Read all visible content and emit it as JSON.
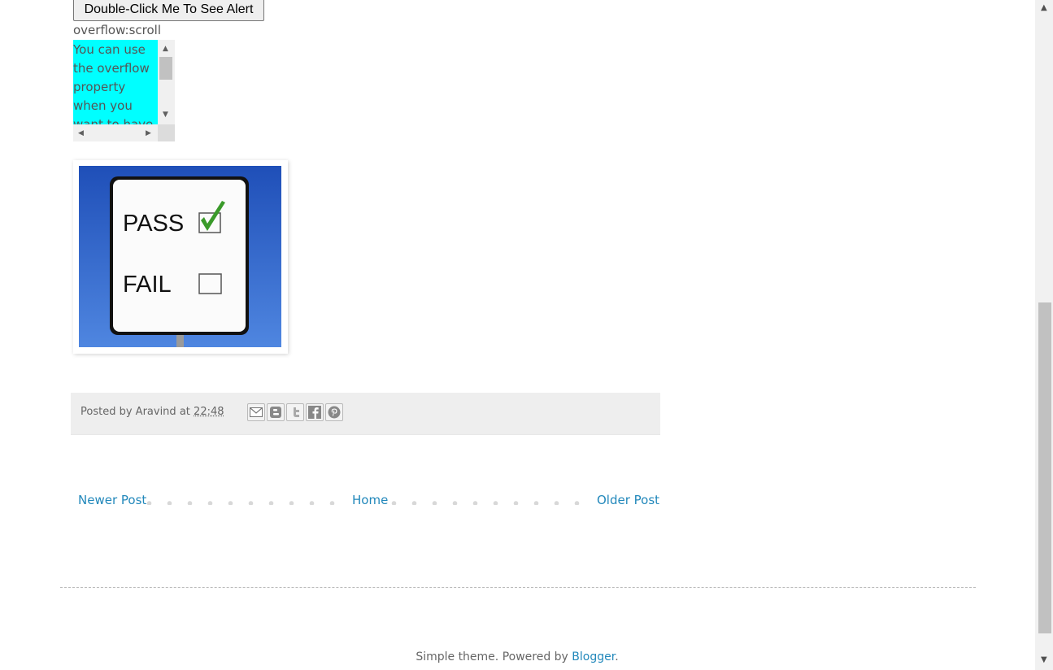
{
  "alert_button": {
    "label": "Double-Click Me To See Alert"
  },
  "overflow_demo": {
    "label": "overflow:scroll",
    "text": "You can use the overflow property when you want to have better control of the layout.",
    "background": "#00ffff"
  },
  "image": {
    "pass_label": "PASS",
    "fail_label": "FAIL",
    "background": "#2b5fc4"
  },
  "post_footer": {
    "posted_by_prefix": "Posted by",
    "author": "Aravind",
    "at_word": "at",
    "time": "22:48",
    "share_icons": [
      "email-icon",
      "blogger-icon",
      "twitter-icon",
      "facebook-icon",
      "pinterest-icon"
    ]
  },
  "blog_pager": {
    "newer": "Newer Post",
    "home": "Home",
    "older": "Older Post"
  },
  "attribution": {
    "prefix": "Simple theme. Powered by",
    "link": "Blogger",
    "suffix": "."
  },
  "colors": {
    "link": "#2288bb",
    "footer_bg": "#eeeeee"
  }
}
